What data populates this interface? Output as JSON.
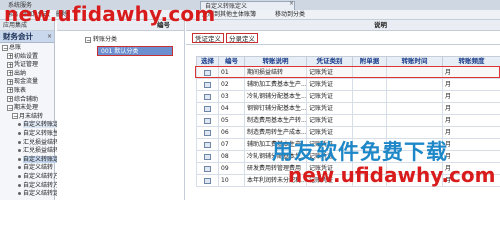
{
  "window": {
    "left_tab": "系统服务",
    "active_tab": "自定义转账定义",
    "close_glyph": "×",
    "right_text": ""
  },
  "toolbar": {
    "buttons": [
      "输出",
      "增加",
      "修改",
      "删除",
      "复制到其他主体账簿",
      "移动到分类"
    ]
  },
  "sidebar": {
    "top_label": "应用集成",
    "section_title": "财务会计",
    "close_glyph": "×",
    "tree": [
      {
        "label": "总账",
        "expander": "−",
        "depth": 0
      },
      {
        "label": "初始设置",
        "expander": "+",
        "depth": 1
      },
      {
        "label": "凭证管理",
        "expander": "+",
        "depth": 1
      },
      {
        "label": "出纳",
        "expander": "+",
        "depth": 1
      },
      {
        "label": "现金流量",
        "expander": "+",
        "depth": 1
      },
      {
        "label": "账表",
        "expander": "+",
        "depth": 1
      },
      {
        "label": "综合辅助",
        "expander": "+",
        "depth": 1
      },
      {
        "label": "期末处理",
        "expander": "−",
        "depth": 1
      },
      {
        "label": "月末结转",
        "expander": "−",
        "depth": 2
      },
      {
        "label": "自定义转账定",
        "expander": "",
        "depth": 3,
        "state": "selected"
      },
      {
        "label": "自定义转账生",
        "expander": "",
        "depth": 3
      },
      {
        "label": "汇兑损益结转",
        "expander": "",
        "depth": 3
      },
      {
        "label": "汇兑损益结转",
        "expander": "",
        "depth": 3
      },
      {
        "label": "自定义转账定",
        "expander": "",
        "depth": 3,
        "state": "highlight"
      },
      {
        "label": "自定义结转",
        "expander": "",
        "depth": 3
      },
      {
        "label": "自定义结转方",
        "expander": "",
        "depth": 3
      },
      {
        "label": "自定义结转方",
        "expander": "",
        "depth": 3
      },
      {
        "label": "自定义结转定",
        "expander": "",
        "depth": 3
      }
    ]
  },
  "middle": {
    "header": "编号",
    "root_label": "转账分类",
    "root_expander": "−",
    "child_label": "001 默认分类"
  },
  "right": {
    "header_left": "",
    "header_desc": "说明",
    "tabs": [
      "凭证定义",
      "分录定义"
    ],
    "columns": [
      "选择",
      "编号",
      "转账说明",
      "凭证类别",
      "附单据",
      "转账时间",
      "转账频度"
    ],
    "rows": [
      {
        "no": "01",
        "desc": "期间损益结转",
        "type": "记账凭证",
        "att": "",
        "time": "",
        "freq": "月"
      },
      {
        "no": "02",
        "desc": "辅助加工费基本生产...",
        "type": "记账凭证",
        "att": "",
        "time": "",
        "freq": "月"
      },
      {
        "no": "03",
        "desc": "冷轧钢辅分配基本生...",
        "type": "记账凭证",
        "att": "",
        "time": "",
        "freq": "月"
      },
      {
        "no": "04",
        "desc": "钢铆钉辅分配基本生...",
        "type": "记账凭证",
        "att": "",
        "time": "",
        "freq": "月"
      },
      {
        "no": "05",
        "desc": "制造费用基本生产转...",
        "type": "记账凭证",
        "att": "",
        "time": "",
        "freq": "月"
      },
      {
        "no": "06",
        "desc": "制造费用转生产成本...",
        "type": "记账凭证",
        "att": "",
        "time": "",
        "freq": "月"
      },
      {
        "no": "07",
        "desc": "辅助加工费基本生产...",
        "type": "记账凭证",
        "att": "",
        "time": "",
        "freq": "月"
      },
      {
        "no": "08",
        "desc": "冷轧钢辅分配基本生...",
        "type": "记账凭证",
        "att": "",
        "time": "",
        "freq": "月"
      },
      {
        "no": "09",
        "desc": "研发费用转管理费用",
        "type": "记账凭证",
        "att": "",
        "time": "",
        "freq": "月"
      },
      {
        "no": "10",
        "desc": "本年利润转未分配利...",
        "type": "记账凭证",
        "att": "",
        "time": "",
        "freq": "月"
      }
    ]
  },
  "watermark": {
    "top_url": "new.ufidawhy.com",
    "cn_text": "用友软件免费下载",
    "bottom_url": "new.ufidawhy.com"
  },
  "colors": {
    "selection_blue": "#6b8fcf",
    "highlight_red": "#d33333",
    "watermark_red": "#d81c1c",
    "watermark_blue": "#1e87c8",
    "header_text": "#1a3d8a"
  }
}
